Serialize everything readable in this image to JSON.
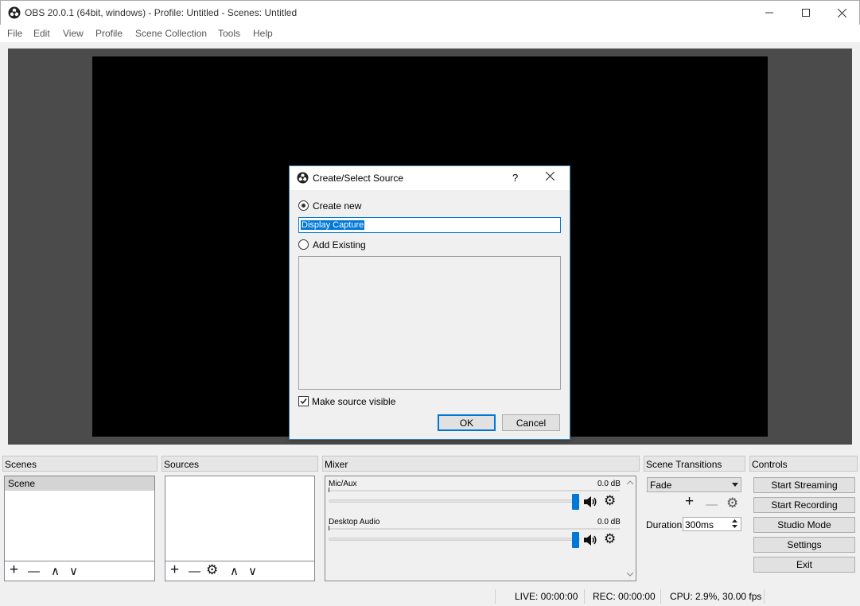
{
  "window": {
    "title": "OBS 20.0.1 (64bit, windows) - Profile: Untitled - Scenes: Untitled",
    "minimize_glyph": "—",
    "maximize_glyph": "☐",
    "close_glyph": "✕"
  },
  "menu": [
    "File",
    "Edit",
    "View",
    "Profile",
    "Scene Collection",
    "Tools",
    "Help"
  ],
  "dialog": {
    "title": "Create/Select Source",
    "help_glyph": "?",
    "close_glyph": "✕",
    "create_new_label": "Create new",
    "name_value": "Display Capture",
    "add_existing_label": "Add Existing",
    "make_visible_label": "Make source visible",
    "ok_label": "OK",
    "cancel_label": "Cancel"
  },
  "docks": {
    "scenes": {
      "title": "Scenes",
      "items": [
        "Scene"
      ]
    },
    "sources": {
      "title": "Sources"
    },
    "mixer": {
      "title": "Mixer",
      "channels": [
        {
          "name": "Mic/Aux",
          "level": "0.0 dB",
          "volume": 1.0
        },
        {
          "name": "Desktop Audio",
          "level": "0.0 dB",
          "volume": 1.0
        }
      ]
    },
    "transitions": {
      "title": "Scene Transitions",
      "selected": "Fade",
      "duration_label": "Duration",
      "duration_value": "300ms"
    },
    "controls": {
      "title": "Controls",
      "buttons": [
        "Start Streaming",
        "Start Recording",
        "Studio Mode",
        "Settings",
        "Exit"
      ]
    }
  },
  "status": {
    "live": "LIVE: 00:00:00",
    "rec": "REC: 00:00:00",
    "cpu": "CPU: 2.9%, 30.00 fps"
  },
  "icons": {
    "add": "+",
    "remove": "—",
    "up": "∧",
    "down": "∨",
    "gear": "⚙",
    "speaker": "🔊"
  },
  "colors": {
    "accent": "#0078d7",
    "preview_bg": "#4b4b4b",
    "canvas_bg": "#000000"
  }
}
